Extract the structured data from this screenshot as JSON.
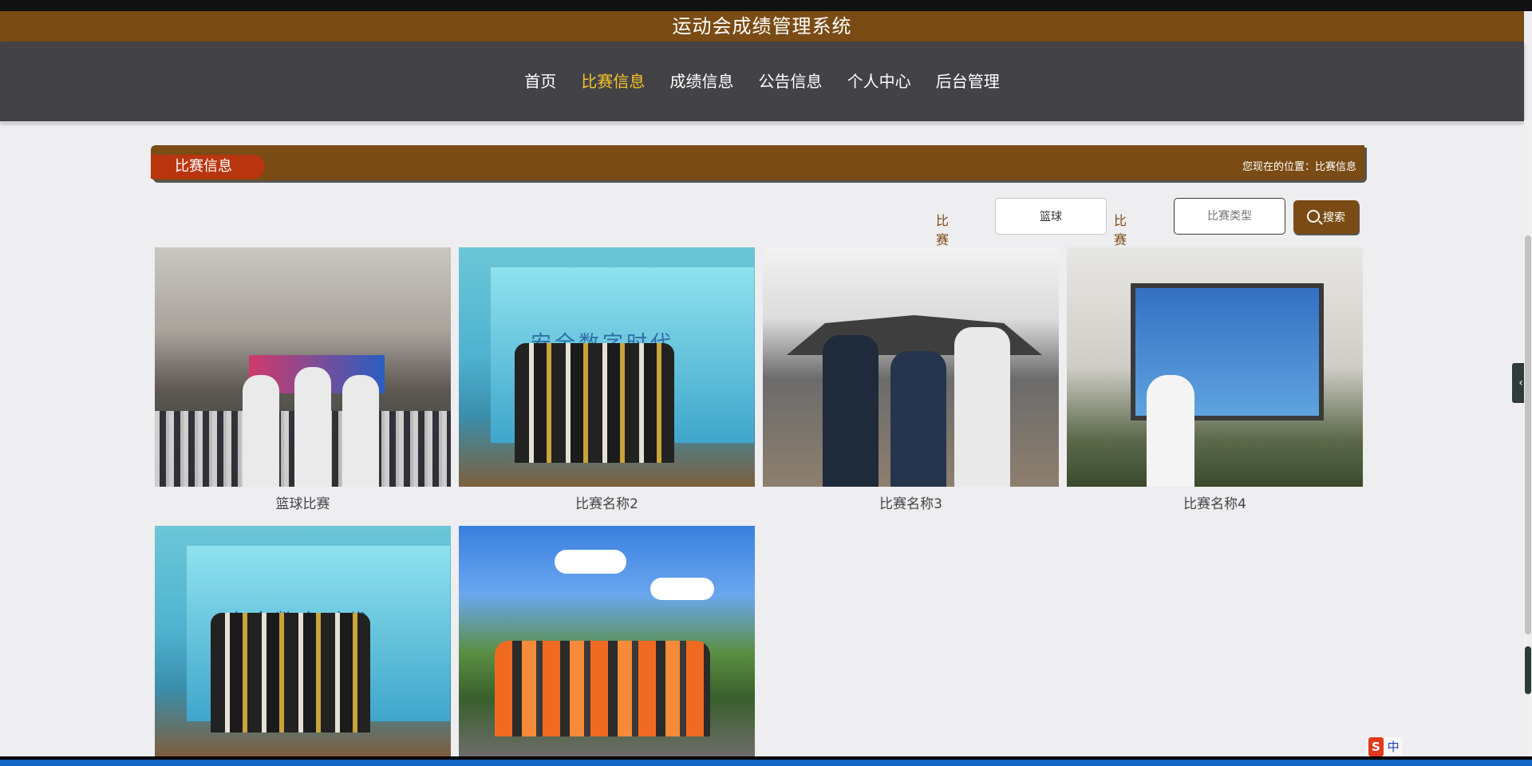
{
  "site": {
    "title": "运动会成绩管理系统"
  },
  "nav": {
    "items": [
      {
        "label": "首页",
        "active": false
      },
      {
        "label": "比赛信息",
        "active": true
      },
      {
        "label": "成绩信息",
        "active": false
      },
      {
        "label": "公告信息",
        "active": false
      },
      {
        "label": "个人中心",
        "active": false
      },
      {
        "label": "后台管理",
        "active": false
      }
    ]
  },
  "section": {
    "title": "比赛信息",
    "breadcrumb": "您现在的位置：比赛信息"
  },
  "search": {
    "name_label": "比赛名称",
    "name_value": "篮球",
    "type_label": "比赛类型",
    "type_placeholder": "比赛类型",
    "button_label": "搜索"
  },
  "cards": [
    {
      "caption": "篮球比赛"
    },
    {
      "caption": "比赛名称2"
    },
    {
      "caption": "比赛名称3"
    },
    {
      "caption": "比赛名称4"
    },
    {
      "caption": ""
    },
    {
      "caption": ""
    }
  ],
  "tray": {
    "label": "中"
  },
  "colors": {
    "brand": "#7a4b14",
    "nav_bg": "#434246",
    "active": "#f6c12a",
    "tab": "#b8350f"
  }
}
